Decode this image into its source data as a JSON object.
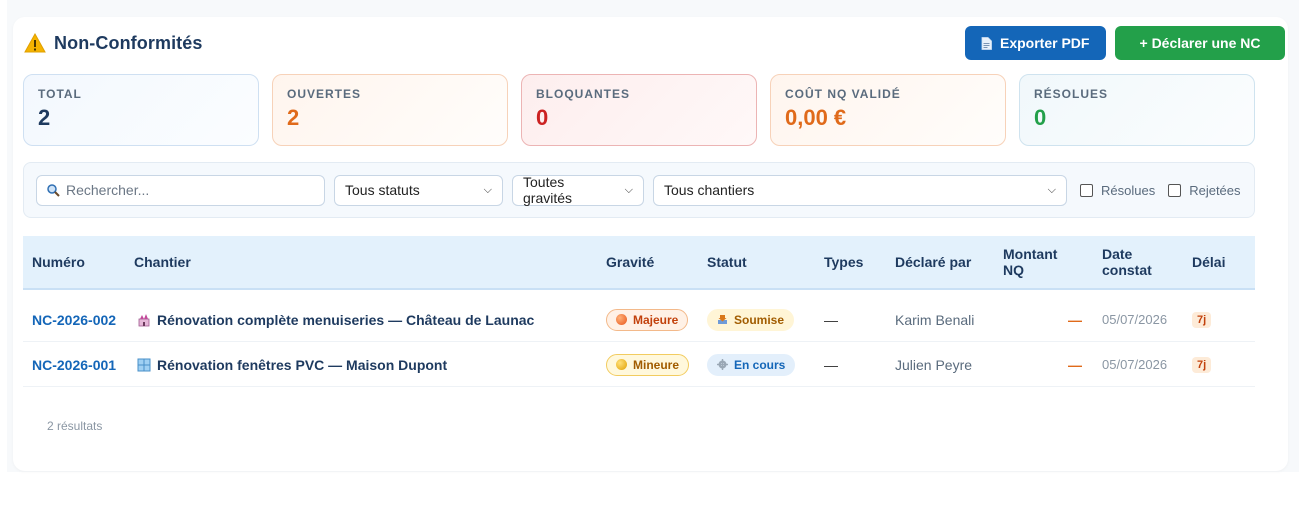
{
  "header": {
    "title": "Non-Conformités",
    "export_label": "Exporter PDF",
    "declare_label": "+ Déclarer une NC"
  },
  "stats": [
    {
      "label": "TOTAL",
      "value": "2"
    },
    {
      "label": "OUVERTES",
      "value": "2"
    },
    {
      "label": "BLOQUANTES",
      "value": "0"
    },
    {
      "label": "COÛT NQ VALIDÉ",
      "value": "0,00 €"
    },
    {
      "label": "RÉSOLUES",
      "value": "0"
    }
  ],
  "filters": {
    "search_placeholder": "Rechercher...",
    "statut": "Tous statuts",
    "gravite": "Toutes gravités",
    "chantier": "Tous chantiers",
    "resolues_label": "Résolues",
    "rejetees_label": "Rejetées"
  },
  "table": {
    "columns": [
      "Numéro",
      "Chantier",
      "Gravité",
      "Statut",
      "Types",
      "Déclaré par",
      "Montant NQ",
      "Date constat",
      "Délai"
    ],
    "rows": [
      {
        "numero": "NC-2026-002",
        "chantier": "Rénovation complète menuiseries — Château de Launac",
        "chantier_icon": "castle-icon",
        "gravite": "Majeure",
        "statut": "Soumise",
        "types": "—",
        "declare_par": "Karim Benali",
        "montant": "—",
        "date": "05/07/2026",
        "delai": "7j"
      },
      {
        "numero": "NC-2026-001",
        "chantier": "Rénovation fenêtres PVC — Maison Dupont",
        "chantier_icon": "window-icon",
        "gravite": "Mineure",
        "statut": "En cours",
        "types": "—",
        "declare_par": "Julien Peyre",
        "montant": "—",
        "date": "05/07/2026",
        "delai": "7j"
      }
    ]
  },
  "results_text": "2 résultats",
  "colors": {
    "primary": "#1466b8",
    "success": "#23a04a",
    "warning": "#e06a1a",
    "danger": "#cc2222",
    "title": "#1e3a5f"
  }
}
